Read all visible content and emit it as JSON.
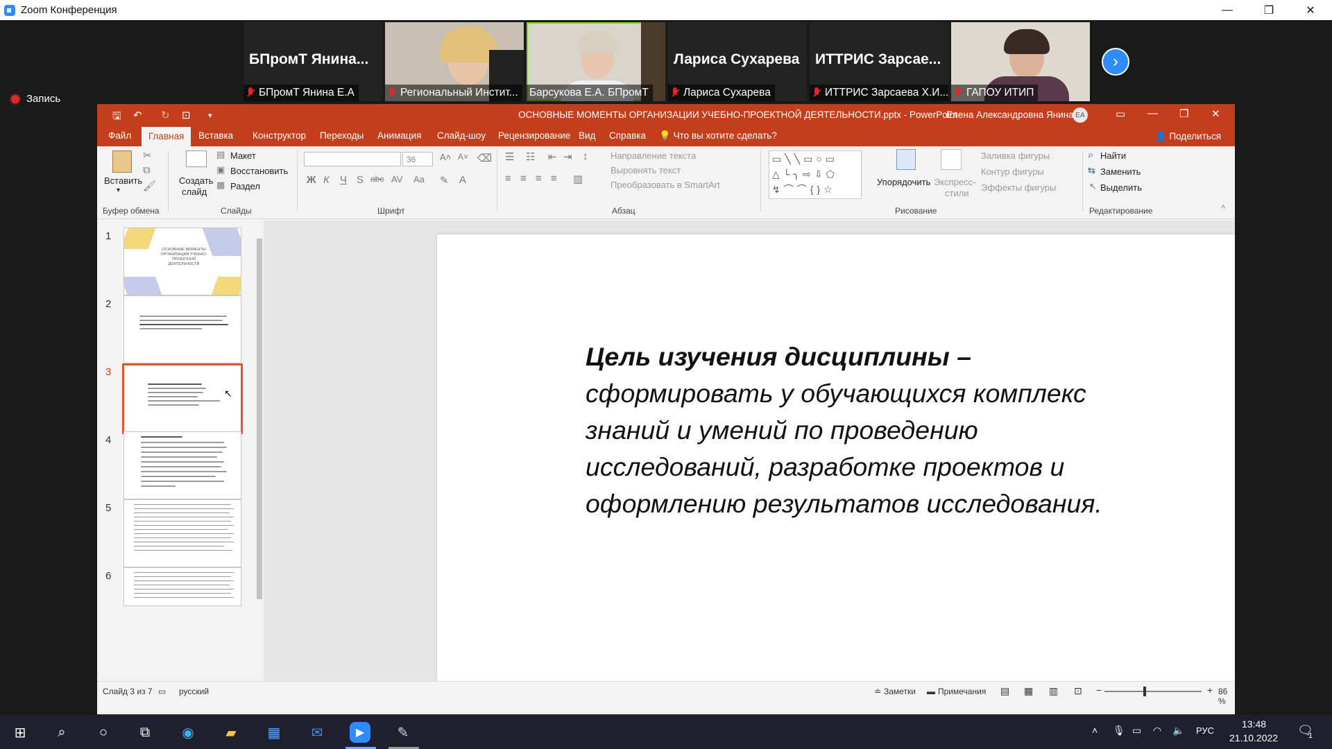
{
  "zoom": {
    "title": "Zoom Конференция",
    "record_label": "Запись",
    "participants": [
      {
        "name_big": "БПромТ  Янина...",
        "label": "БПромТ Янина Е.А",
        "video": false
      },
      {
        "name_big": "",
        "label": "Региональный Инстит...",
        "video": true
      },
      {
        "name_big": "",
        "label": "Барсукова Е.А. БПромТ",
        "video": true,
        "active": true
      },
      {
        "name_big": "Лариса Сухарева",
        "label": "Лариса Сухарева",
        "video": false
      },
      {
        "name_big": "ИТТРИС  Зарсае...",
        "label": "ИТТРИС Зарсаева Х.И...",
        "video": false
      },
      {
        "name_big": "",
        "label": "ГАПОУ ИТИП",
        "video": true
      }
    ]
  },
  "ppt": {
    "doc_title": "ОСНОВНЫЕ МОМЕНТЫ ОРГАНИЗАЦИИ УЧЕБНО-ПРОЕКТНОЙ ДЕЯТЕЛЬНОСТИ.pptx  -  PowerPoint",
    "user": "Елена Александровна Янина",
    "avatar": "ЕА",
    "tabs": [
      "Файл",
      "Главная",
      "Вставка",
      "Конструктор",
      "Переходы",
      "Анимация",
      "Слайд-шоу",
      "Рецензирование",
      "Вид",
      "Справка"
    ],
    "search_hint": "Что вы хотите сделать?",
    "share": "Поделиться",
    "ribbon": {
      "paste": "Вставить",
      "clipboard_group": "Буфер обмена",
      "new_slide_1": "Создать",
      "new_slide_2": "слайд",
      "layout": "Макет",
      "reset": "Восстановить",
      "section": "Раздел",
      "slides_group": "Слайды",
      "font_group": "Шрифт",
      "font_size": "36",
      "paragraph_group": "Абзац",
      "text_direction": "Направление текста",
      "align_text": "Выровнять текст",
      "smartart": "Преобразовать в SmartArt",
      "arrange": "Упорядочить",
      "quick_styles_1": "Экспресс-",
      "quick_styles_2": "стили",
      "shape_fill": "Заливка фигуры",
      "shape_outline": "Контур фигуры",
      "shape_effects": "Эффекты фигуры",
      "drawing_group": "Рисование",
      "find": "Найти",
      "replace": "Заменить",
      "select": "Выделить",
      "editing_group": "Редактирование"
    },
    "thumbnails": [
      "1",
      "2",
      "3",
      "4",
      "5",
      "6"
    ],
    "thumb1_text": "ОСНОВНЫЕ МОМЕНТЫ ОРГАНИЗАЦИИ УЧЕБНО-ПРОЕКТНОЙ ДЕЯТЕЛЬНОСТИ",
    "slide": {
      "bold_part": "Цель изучения дисциплины –",
      "rest": "сформировать у обучающихся комплекс знаний и умений по проведению исследований, разработке проектов и оформлению результатов исследования."
    },
    "status": {
      "slide_of": "Слайд 3 из 7",
      "language": "русский",
      "notes": "Заметки",
      "comments": "Примечания",
      "zoom": "86 %"
    }
  },
  "taskbar": {
    "language": "РУС",
    "time": "13:48",
    "date": "21.10.2022",
    "notif_count": "1"
  }
}
